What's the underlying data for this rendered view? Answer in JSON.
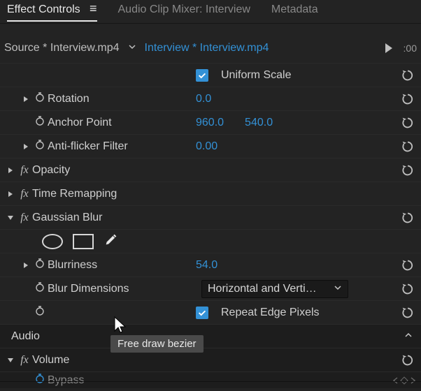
{
  "tabs": {
    "effectControls": "Effect Controls",
    "audioMixer": "Audio Clip Mixer: Interview",
    "metadata": "Metadata"
  },
  "source": {
    "clip": "Source * Interview.mp4",
    "sequence": "Interview * Interview.mp4",
    "timecode": ":00"
  },
  "motion": {
    "uniformScaleLabel": "Uniform Scale",
    "rotationLabel": "Rotation",
    "rotationValue": "0.0",
    "anchorLabel": "Anchor Point",
    "anchorX": "960.0",
    "anchorY": "540.0",
    "antiFlickerLabel": "Anti-flicker Filter",
    "antiFlickerValue": "0.00"
  },
  "opacityLabel": "Opacity",
  "timeRemapLabel": "Time Remapping",
  "gaussian": {
    "label": "Gaussian Blur",
    "blurrinessLabel": "Blurriness",
    "blurrinessValue": "54.0",
    "dimLabel": "Blur Dimensions",
    "dimValue": "Horizontal and Verti…",
    "repeatLabel": "Repeat Edge Pixels"
  },
  "audioLabel": "Audio",
  "volume": {
    "label": "Volume",
    "bypassLabel": "Bypass"
  },
  "tooltip": "Free draw bezier"
}
